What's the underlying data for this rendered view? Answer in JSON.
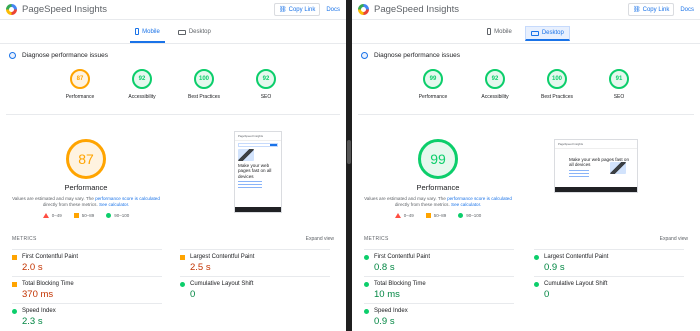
{
  "app": {
    "title": "PageSpeed Insights",
    "copy_link": "Copy Link",
    "docs": "Docs"
  },
  "colors": {
    "accent": "#1a73e8",
    "good": "#0cce6b",
    "average": "#ffa400",
    "poor": "#ff4e42"
  },
  "tabs": {
    "mobile": "Mobile",
    "desktop": "Desktop"
  },
  "diagnose": "Diagnose performance issues",
  "legend": {
    "poor": "0–49",
    "average": "50–89",
    "good": "90–100"
  },
  "perf_title": "Performance",
  "perf_desc_1": "Values are estimated and may vary. The",
  "perf_desc_link1": "performance score is calculated",
  "perf_desc_2": "directly from these metrics.",
  "perf_desc_link2": "See calculator.",
  "metrics_heading": "METRICS",
  "expand_view": "Expand view",
  "screenshot_text": {
    "app": "PageSpeed Insights",
    "headline": "Make your web pages fast on all devices"
  },
  "mobile": {
    "active_tab": "Mobile",
    "scores": [
      {
        "value": "87",
        "label": "Performance",
        "level": "average"
      },
      {
        "value": "92",
        "label": "Accessibility",
        "level": "good"
      },
      {
        "value": "100",
        "label": "Best Practices",
        "level": "good"
      },
      {
        "value": "92",
        "label": "SEO",
        "level": "good"
      }
    ],
    "performance": "87",
    "metrics": [
      {
        "name": "First Contentful Paint",
        "value": "2.0 s",
        "level": "average"
      },
      {
        "name": "Largest Contentful Paint",
        "value": "2.5 s",
        "level": "average"
      },
      {
        "name": "Total Blocking Time",
        "value": "370 ms",
        "level": "average"
      },
      {
        "name": "Cumulative Layout Shift",
        "value": "0",
        "level": "good"
      },
      {
        "name": "Speed Index",
        "value": "2.3 s",
        "level": "good"
      }
    ]
  },
  "desktop": {
    "active_tab": "Desktop",
    "scores": [
      {
        "value": "99",
        "label": "Performance",
        "level": "good"
      },
      {
        "value": "92",
        "label": "Accessibility",
        "level": "good"
      },
      {
        "value": "100",
        "label": "Best Practices",
        "level": "good"
      },
      {
        "value": "91",
        "label": "SEO",
        "level": "good"
      }
    ],
    "performance": "99",
    "metrics": [
      {
        "name": "First Contentful Paint",
        "value": "0.8 s",
        "level": "good"
      },
      {
        "name": "Largest Contentful Paint",
        "value": "0.9 s",
        "level": "good"
      },
      {
        "name": "Total Blocking Time",
        "value": "10 ms",
        "level": "good"
      },
      {
        "name": "Cumulative Layout Shift",
        "value": "0",
        "level": "good"
      },
      {
        "name": "Speed Index",
        "value": "0.9 s",
        "level": "good"
      }
    ]
  }
}
